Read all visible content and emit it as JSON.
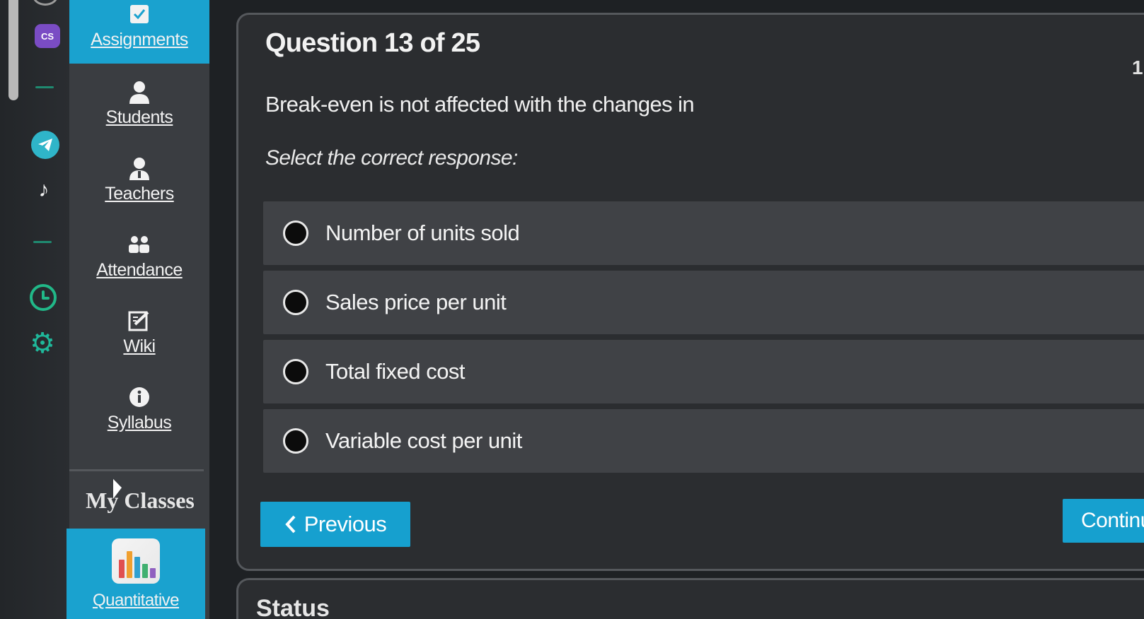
{
  "colors": {
    "accent": "#1aa2cf",
    "nav_bg": "#3a3d41",
    "panel_bg": "#2b2d30",
    "option_bg": "#404246",
    "rail_green": "#21b888",
    "rail_purple": "#7a4cc4",
    "telegram_blue": "#2fb5c9"
  },
  "rail": {
    "cs_label": "CS",
    "icons": [
      "cs-app-icon",
      "telegram-icon",
      "tiktok-icon",
      "clock-icon",
      "gear-icon"
    ]
  },
  "nav": {
    "items": [
      {
        "label": "Assignments",
        "icon": "checkbox-icon",
        "active": true
      },
      {
        "label": "Students",
        "icon": "person-icon"
      },
      {
        "label": "Teachers",
        "icon": "teacher-icon"
      },
      {
        "label": "Attendance",
        "icon": "people-icon"
      },
      {
        "label": "Wiki",
        "icon": "edit-icon"
      },
      {
        "label": "Syllabus",
        "icon": "info-icon"
      }
    ],
    "my_classes_label": "My Classes",
    "class_card_label": "Quantitative"
  },
  "question": {
    "header": "Question 13 of 25",
    "edge_number": "1",
    "text": "Break-even is not affected with the changes in",
    "instruction": "Select the correct response:",
    "options": [
      "Number of units sold",
      "Sales price per unit",
      "Total fixed cost",
      "Variable cost per unit"
    ],
    "previous_label": "Previous",
    "continue_label": "Continu"
  },
  "status": {
    "title": "Status"
  }
}
